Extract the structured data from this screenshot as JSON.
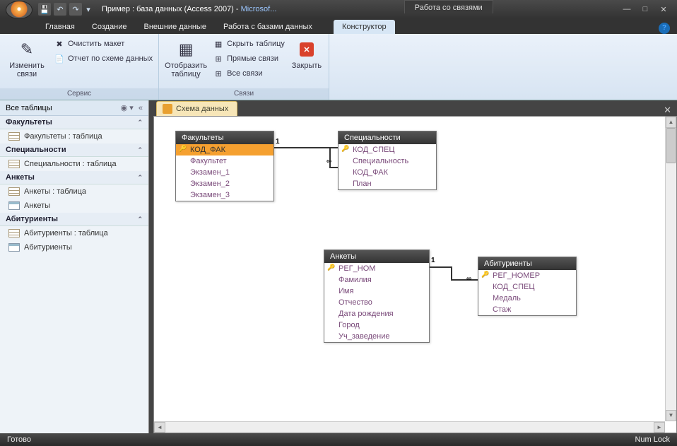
{
  "title": {
    "doc": "Пример : база данных (Access 2007)",
    "app": "Microsof..."
  },
  "context_group": "Работа со связями",
  "tabs": [
    "Главная",
    "Создание",
    "Внешние данные",
    "Работа с базами данных"
  ],
  "context_tab": "Конструктор",
  "ribbon": {
    "g1": {
      "label": "Сервис",
      "big": "Изменить связи",
      "s1": "Очистить макет",
      "s2": "Отчет по схеме данных"
    },
    "g2": {
      "label": "Связи",
      "big": "Отобразить таблицу",
      "s1": "Скрыть таблицу",
      "s2": "Прямые связи",
      "s3": "Все связи",
      "close": "Закрыть"
    }
  },
  "nav": {
    "header": "Все таблицы",
    "groups": [
      {
        "title": "Факультеты",
        "items": [
          {
            "t": "tbl",
            "label": "Факультеты : таблица"
          }
        ]
      },
      {
        "title": "Специальности",
        "items": [
          {
            "t": "tbl",
            "label": "Специальности : таблица"
          }
        ]
      },
      {
        "title": "Анкеты",
        "items": [
          {
            "t": "tbl",
            "label": "Анкеты : таблица"
          },
          {
            "t": "frm",
            "label": "Анкеты"
          }
        ]
      },
      {
        "title": "Абитуриенты",
        "items": [
          {
            "t": "tbl",
            "label": "Абитуриенты : таблица"
          },
          {
            "t": "frm",
            "label": "Абитуриенты"
          }
        ]
      }
    ]
  },
  "doc_tab": "Схема данных",
  "tables": {
    "t1": {
      "title": "Факультеты",
      "fields": [
        {
          "n": "КОД_ФАК",
          "k": true,
          "sel": true
        },
        {
          "n": "Факультет"
        },
        {
          "n": "Экзамен_1"
        },
        {
          "n": "Экзамен_2"
        },
        {
          "n": "Экзамен_3"
        }
      ]
    },
    "t2": {
      "title": "Специальности",
      "fields": [
        {
          "n": "КОД_СПЕЦ",
          "k": true
        },
        {
          "n": "Специальность"
        },
        {
          "n": "КОД_ФАК"
        },
        {
          "n": "План"
        }
      ]
    },
    "t3": {
      "title": "Анкеты",
      "fields": [
        {
          "n": "РЕГ_НОМ",
          "k": true
        },
        {
          "n": "Фамилия"
        },
        {
          "n": "Имя"
        },
        {
          "n": "Отчество"
        },
        {
          "n": "Дата рождения"
        },
        {
          "n": "Город"
        },
        {
          "n": "Уч_заведение"
        }
      ]
    },
    "t4": {
      "title": "Абитуриенты",
      "fields": [
        {
          "n": "РЕГ_НОМЕР",
          "k": true
        },
        {
          "n": "КОД_СПЕЦ"
        },
        {
          "n": "Медаль"
        },
        {
          "n": "Стаж"
        }
      ]
    }
  },
  "rel": {
    "one": "1",
    "many": "∞"
  },
  "status": {
    "left": "Готово",
    "right": "Num Lock"
  }
}
